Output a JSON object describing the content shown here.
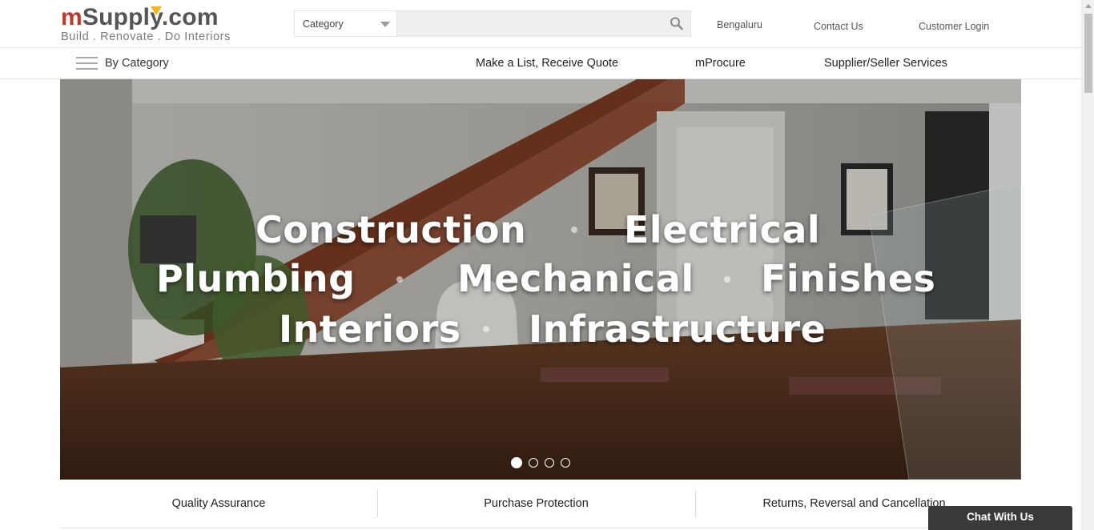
{
  "logo": {
    "m": "m",
    "supply": "Suppl",
    "y": "y",
    "dotcom": ".com",
    "tagline": "Build . Renovate . Do Interiors"
  },
  "search": {
    "category_label": "Category",
    "placeholder": ""
  },
  "top_links": {
    "location": "Bengaluru",
    "contact": "Contact Us",
    "login": "Customer Login"
  },
  "nav": {
    "by_category": "By Category",
    "links": [
      "Make a List, Receive Quote",
      "mProcure",
      "Supplier/Seller Services"
    ]
  },
  "hero": {
    "row1": [
      "Construction",
      "Electrical"
    ],
    "row2": [
      "Plumbing",
      "Mechanical",
      "Finishes"
    ],
    "row3": [
      "Interiors",
      "Infrastructure"
    ],
    "slide_count": 4,
    "active_slide": 1
  },
  "features": [
    "Quality Assurance",
    "Purchase Protection",
    "Returns, Reversal and Cancellation"
  ],
  "chat": {
    "label": "Chat With Us"
  },
  "colors": {
    "brand_red": "#c0392b",
    "brand_yellow": "#f3b521",
    "chat_bg": "#3a3a3a"
  },
  "icons": {
    "search": "search-icon",
    "menu": "hamburger-menu-icon",
    "dropdown": "caret-down-icon"
  }
}
